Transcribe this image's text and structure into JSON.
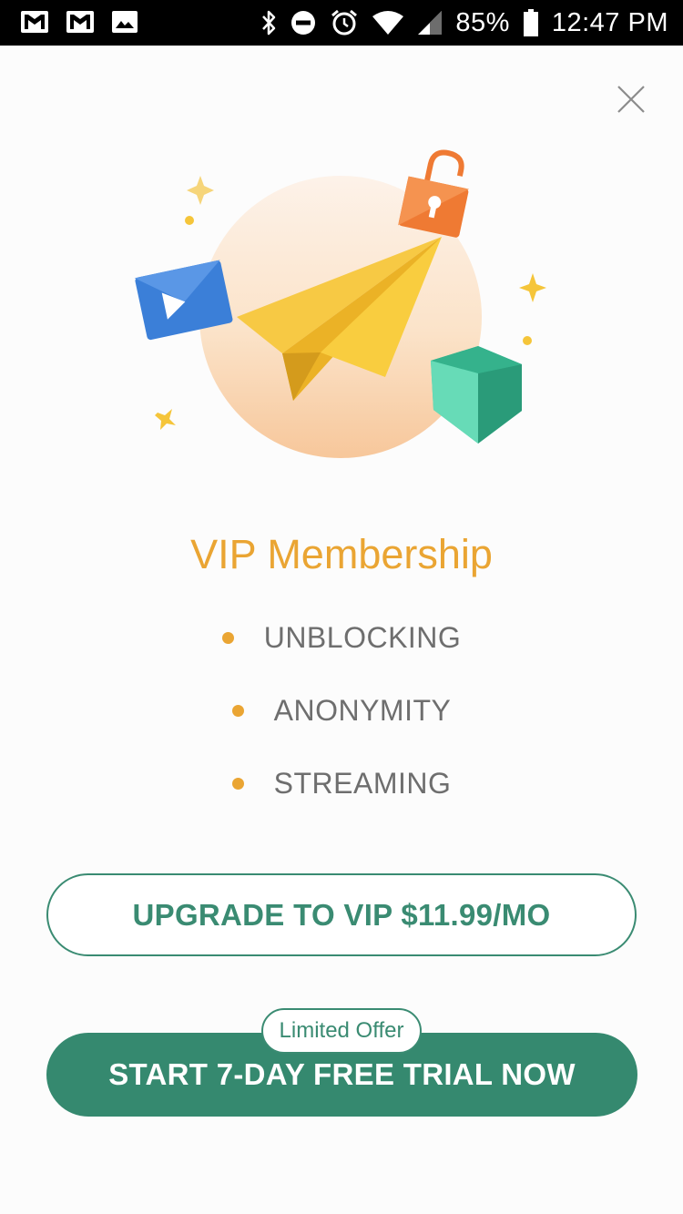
{
  "status_bar": {
    "left_icons": [
      "gmail-icon",
      "gmail-icon",
      "image-icon"
    ],
    "right_icons": [
      "bluetooth-icon",
      "do-not-disturb-icon",
      "alarm-icon",
      "wifi-icon",
      "signal-icon"
    ],
    "battery": "85%",
    "battery_icon": "battery-icon",
    "time": "12:47 PM"
  },
  "dialog": {
    "close_icon": "close-icon",
    "hero_illustration": "paper-plane-illustration",
    "title": "VIP Membership",
    "features": [
      "UNBLOCKING",
      "ANONYMITY",
      "STREAMING"
    ],
    "upgrade_label": "UPGRADE TO VIP $11.99/MO",
    "offer_badge": "Limited Offer",
    "trial_label": "START 7-DAY FREE TRIAL NOW"
  },
  "colors": {
    "accent_orange": "#eaa533",
    "brand_green": "#35896f",
    "feature_text": "#6e6e6e",
    "status_bar_bg": "#000000"
  }
}
